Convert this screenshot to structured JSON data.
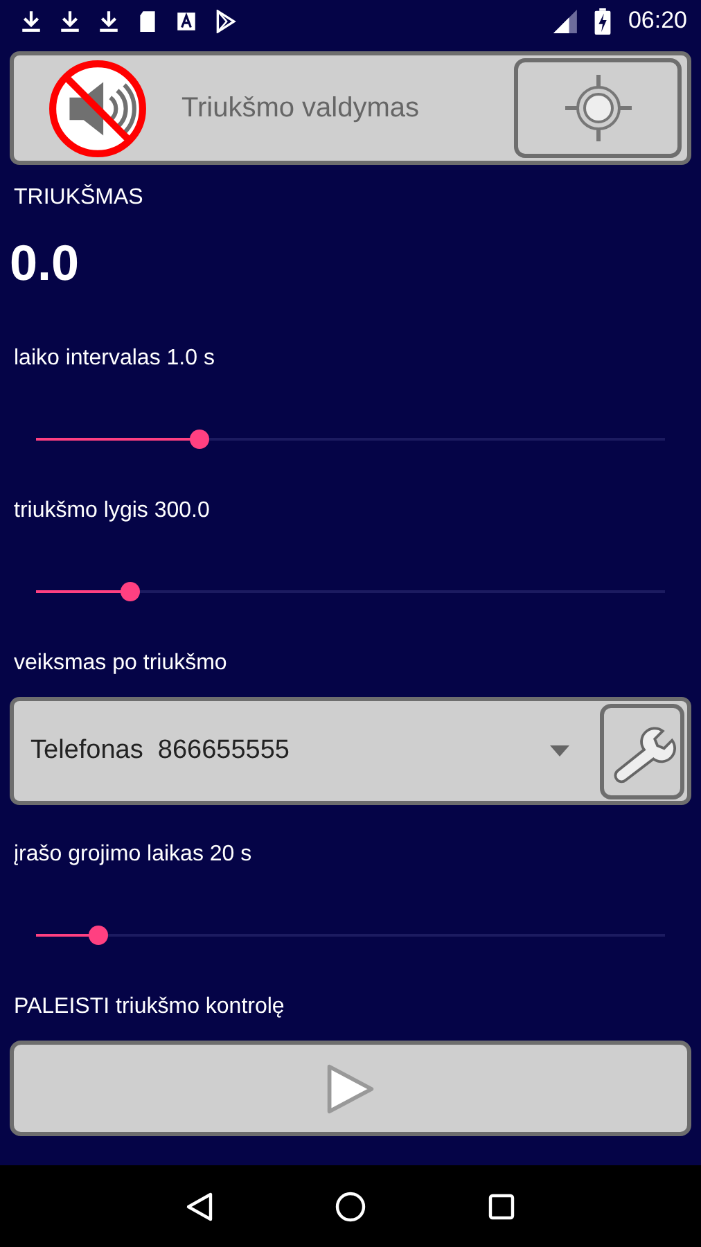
{
  "status_bar": {
    "time": "06:20"
  },
  "header": {
    "title": "Triukšmo valdymas"
  },
  "noise": {
    "label": "TRIUKŠMAS",
    "value": "0.0"
  },
  "interval": {
    "label": "laiko intervalas 1.0 s",
    "level": 0.26
  },
  "threshold": {
    "label": "triukšmo lygis 300.0",
    "level": 0.15
  },
  "action": {
    "label": "veiksmas po triukšmo",
    "value": "Telefonas  866655555"
  },
  "playback": {
    "label": "įrašo grojimo laikas 20 s",
    "level": 0.1
  },
  "start": {
    "label": "PALEISTI triukšmo kontrolę"
  }
}
